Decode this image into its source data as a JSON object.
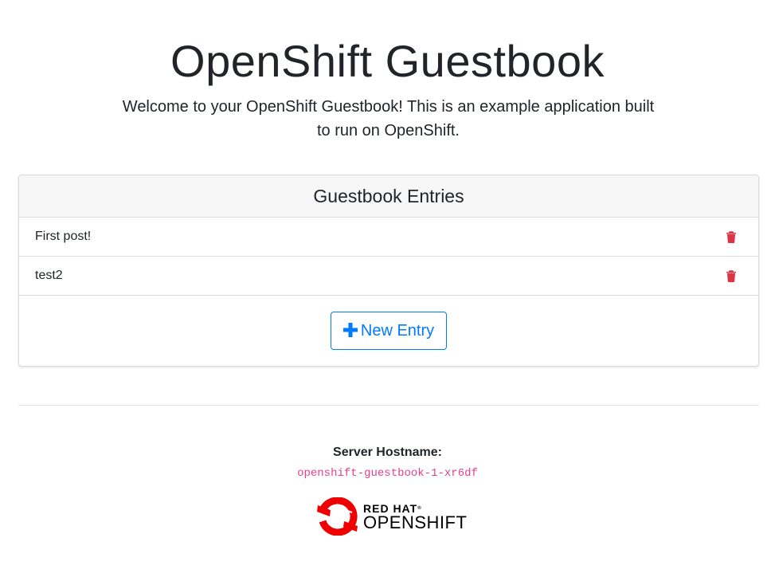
{
  "header": {
    "title": "OpenShift Guestbook",
    "lead": "Welcome to your OpenShift Guestbook! This is an example application built to run on OpenShift."
  },
  "card": {
    "header": "Guestbook Entries",
    "entries": [
      {
        "text": "First post!",
        "delete_icon": "trash-icon"
      },
      {
        "text": "test2",
        "delete_icon": "trash-icon"
      }
    ],
    "new_entry_label": "New Entry",
    "new_entry_icon": "plus-icon"
  },
  "footer": {
    "hostname_label": "Server Hostname:",
    "hostname_value": "openshift-guestbook-1-xr6df",
    "logo": {
      "line1": "RED HAT",
      "trademark": "®",
      "line2": "OPENSHIFT"
    }
  },
  "colors": {
    "accent": "#007bff",
    "danger": "#dc3545",
    "code": "#e83e8c",
    "redhat": "#ee0000"
  }
}
